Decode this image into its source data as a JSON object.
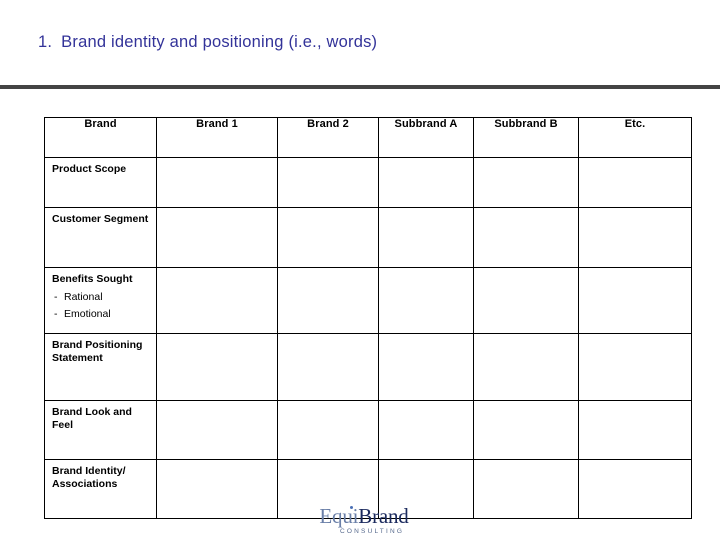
{
  "slide": {
    "title_number": "1.",
    "title_text": "Brand identity and positioning (i.e., words)"
  },
  "matrix": {
    "columns": [
      "Brand",
      "Brand 1",
      "Brand 2",
      "Subbrand A",
      "Subbrand B",
      "Etc."
    ],
    "rows": [
      {
        "label": "Product Scope",
        "sub_items": [],
        "cells": [
          "",
          "",
          "",
          "",
          ""
        ]
      },
      {
        "label": "Customer Segment",
        "sub_items": [],
        "cells": [
          "",
          "",
          "",
          "",
          ""
        ]
      },
      {
        "label": "Benefits Sought",
        "sub_items": [
          "Rational",
          "Emotional"
        ],
        "cells": [
          "",
          "",
          "",
          "",
          ""
        ]
      },
      {
        "label": "Brand Positioning Statement",
        "sub_items": [],
        "cells": [
          "",
          "",
          "",
          "",
          ""
        ]
      },
      {
        "label": "Brand Look and Feel",
        "sub_items": [],
        "cells": [
          "",
          "",
          "",
          "",
          ""
        ]
      },
      {
        "label": "Brand Identity/ Associations",
        "sub_items": [],
        "cells": [
          "",
          "",
          "",
          "",
          ""
        ]
      }
    ],
    "sub_item_bullet": "-"
  },
  "logo": {
    "word_part_1": "Equi",
    "word_part_2": "Brand",
    "tagline": "CONSULTING"
  },
  "colors": {
    "title_navy": "#333399",
    "header_blue": "#c6d6f7",
    "rule_gray": "#444444",
    "border_black": "#000000",
    "logo_equi": "#6a7fa8",
    "logo_brand": "#1b2a5e",
    "logo_tagline": "#55688c"
  }
}
